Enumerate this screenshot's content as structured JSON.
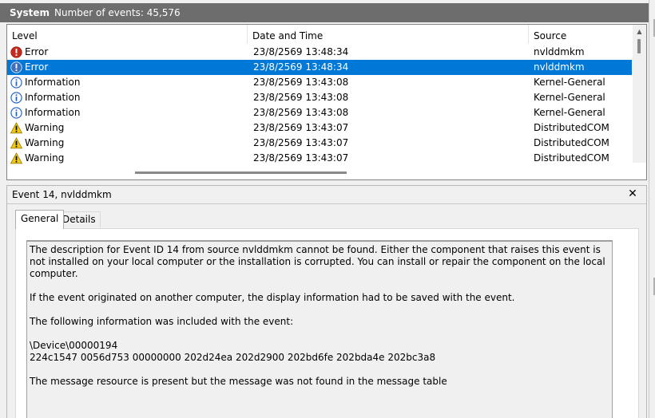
{
  "header": {
    "title": "System",
    "event_count_text": "Number of events: 45,576"
  },
  "grid": {
    "columns": {
      "level": "Level",
      "date": "Date and Time",
      "source": "Source"
    },
    "rows": [
      {
        "level": "Error",
        "icon": "error-icon",
        "date": "23/8/2569 13:48:34",
        "source": "nvlddmkm",
        "selected": false
      },
      {
        "level": "Error",
        "icon": "error-icon",
        "date": "23/8/2569 13:48:34",
        "source": "nvlddmkm",
        "selected": true
      },
      {
        "level": "Information",
        "icon": "info-icon",
        "date": "23/8/2569 13:43:08",
        "source": "Kernel-General",
        "selected": false
      },
      {
        "level": "Information",
        "icon": "info-icon",
        "date": "23/8/2569 13:43:08",
        "source": "Kernel-General",
        "selected": false
      },
      {
        "level": "Information",
        "icon": "info-icon",
        "date": "23/8/2569 13:43:08",
        "source": "Kernel-General",
        "selected": false
      },
      {
        "level": "Warning",
        "icon": "warning-icon",
        "date": "23/8/2569 13:43:07",
        "source": "DistributedCOM",
        "selected": false
      },
      {
        "level": "Warning",
        "icon": "warning-icon",
        "date": "23/8/2569 13:43:07",
        "source": "DistributedCOM",
        "selected": false
      },
      {
        "level": "Warning",
        "icon": "warning-icon",
        "date": "23/8/2569 13:43:07",
        "source": "DistributedCOM",
        "selected": false
      }
    ]
  },
  "detail": {
    "title": "Event 14, nvlddmkm",
    "close_label": "✕",
    "tabs": {
      "general": "General",
      "details": "Details"
    },
    "description": {
      "p1": "The description for Event ID 14 from source nvlddmkm cannot be found. Either the component that raises this event is not installed on your local computer or the installation is corrupted. You can install or repair the component on the local computer.",
      "p2": "If the event originated on another computer, the display information had to be saved with the event.",
      "p3": "The following information was included with the event:",
      "p4_line1": "\\Device\\00000194",
      "p4_line2": "224c1547 0056d753 00000000 202d24ea 202d2900 202bd6fe 202bda4e 202bc3a8",
      "p5": "The message resource is present but the message was not found in the message table"
    }
  },
  "colors": {
    "selection": "#0078d7",
    "header_bg": "#6d6d6d",
    "error": "#c42b1c",
    "info": "#1f5fbf",
    "warning": "#f2c811"
  }
}
